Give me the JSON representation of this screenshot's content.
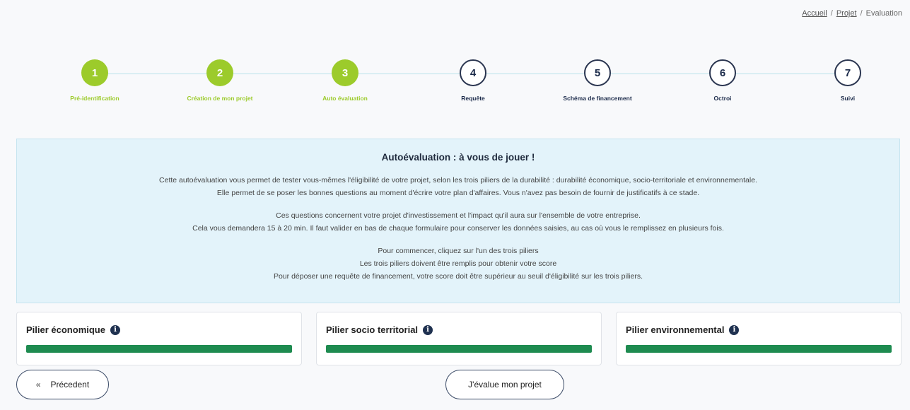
{
  "breadcrumb": {
    "home": "Accueil",
    "sep": "/",
    "project": "Projet",
    "current": "Evaluation"
  },
  "steps": [
    {
      "number": "1",
      "label": "Pré-identification",
      "state": "done"
    },
    {
      "number": "2",
      "label": "Création de mon projet",
      "state": "done"
    },
    {
      "number": "3",
      "label": "Auto évaluation",
      "state": "done"
    },
    {
      "number": "4",
      "label": "Requête",
      "state": "todo"
    },
    {
      "number": "5",
      "label": "Schéma de financement",
      "state": "todo"
    },
    {
      "number": "6",
      "label": "Octroi",
      "state": "todo"
    },
    {
      "number": "7",
      "label": "Suivi",
      "state": "todo"
    }
  ],
  "intro": {
    "title": "Autoévaluation : à vous de jouer !",
    "p1_l1": "Cette autoévaluation vous permet de tester vous-mêmes l'éligibilité de votre projet, selon les trois piliers de la durabilité : durabilité économique, socio-territoriale et environnementale.",
    "p1_l2": "Elle permet de se poser les bonnes questions au moment d'écrire votre plan d'affaires. Vous n'avez pas besoin de fournir de justificatifs à ce stade.",
    "p2_l1": "Ces questions concernent votre projet d'investissement et l'impact qu'il aura sur l'ensemble de votre entreprise.",
    "p2_l2": "Cela vous demandera 15 à 20 min. Il faut valider en bas de chaque formulaire pour conserver les données saisies, au cas où vous le remplissez en plusieurs fois.",
    "p3_l1": "Pour commencer, cliquez sur l'un des trois piliers",
    "p3_l2": "Les trois piliers doivent être remplis pour obtenir votre score",
    "p3_l3": "Pour déposer une requête de financement, votre score doit être supérieur au seuil d'éligibilité sur les trois piliers."
  },
  "pillars": [
    {
      "title": "Pilier économique",
      "progress": 1.0
    },
    {
      "title": "Pilier socio territorial",
      "progress": 1.0
    },
    {
      "title": "Pilier environnemental",
      "progress": 1.0
    }
  ],
  "buttons": {
    "previous": "Précedent",
    "previous_icon": "«",
    "evaluate": "J'évalue mon projet"
  },
  "colors": {
    "done": "#9ccb2b",
    "progress": "#1e8b50",
    "intro_bg": "#e3f3fa",
    "dark": "#1b2a4a"
  }
}
